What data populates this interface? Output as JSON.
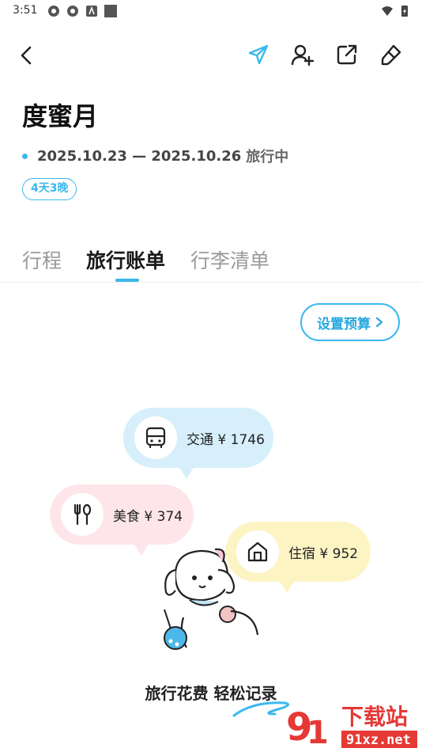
{
  "status_bar": {
    "time": "3:51"
  },
  "trip": {
    "title": "度蜜月",
    "date_range": "2025.10.23 — 2025.10.26",
    "status": "旅行中",
    "duration": "4天3晚"
  },
  "tabs": [
    {
      "label": "行程"
    },
    {
      "label": "旅行账单"
    },
    {
      "label": "行李清单"
    }
  ],
  "budget": {
    "label": "设置预算"
  },
  "expenses": [
    {
      "label": "交通 ¥ 1746",
      "icon": "bus-icon",
      "color": "#d6effb"
    },
    {
      "label": "美食 ¥ 374",
      "icon": "fork-spoon-icon",
      "color": "#fde5ea"
    },
    {
      "label": "住宿 ¥ 952",
      "icon": "house-icon",
      "color": "#fdf4c4"
    }
  ],
  "tagline": "旅行花费 轻松记录",
  "watermark": {
    "brand": "下载站",
    "site": "91xz.net"
  },
  "accent_color": "#3bb8ee"
}
